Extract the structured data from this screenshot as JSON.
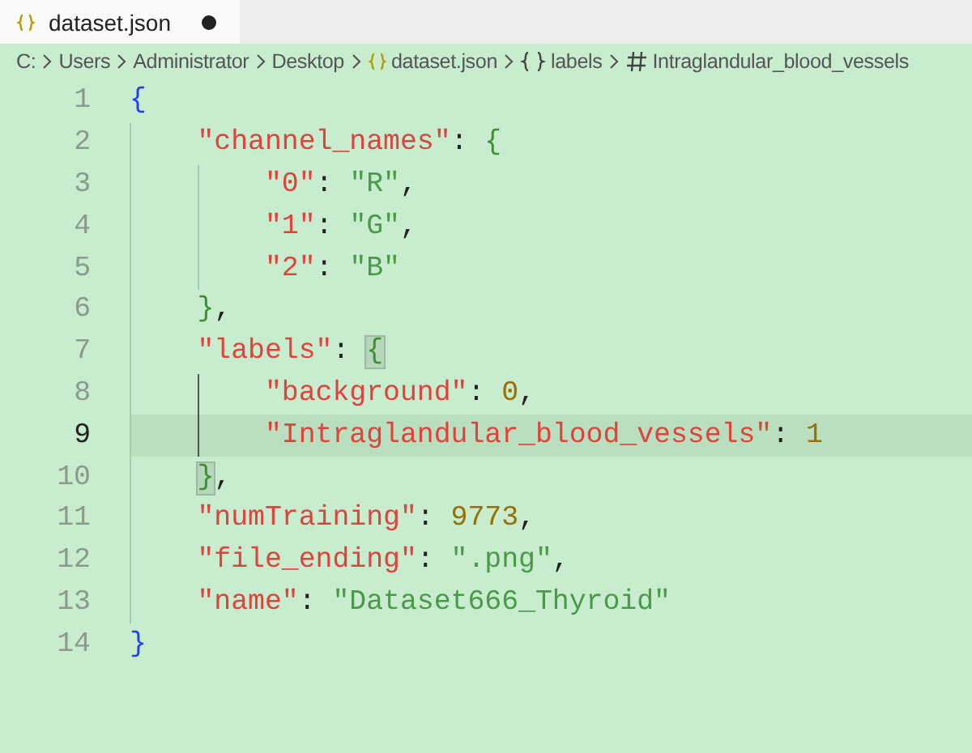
{
  "tab": {
    "title": "dataset.json",
    "modified": true,
    "selected": true
  },
  "breadcrumb": [
    {
      "label": "C:",
      "kind": "folder"
    },
    {
      "label": "Users",
      "kind": "folder"
    },
    {
      "label": "Administrator",
      "kind": "folder"
    },
    {
      "label": "Desktop",
      "kind": "folder"
    },
    {
      "label": "dataset.json",
      "kind": "file"
    },
    {
      "label": "labels",
      "kind": "object"
    },
    {
      "label": "Intraglandular_blood_vessels",
      "kind": "property"
    }
  ],
  "lines": [
    {
      "number": "1",
      "current": false,
      "tokens": [
        {
          "text": "{",
          "kind": "brace1"
        }
      ]
    },
    {
      "number": "2",
      "current": false,
      "tokens": [
        {
          "text": "    \"channel_names\"",
          "kind": "key"
        },
        {
          "text": ": ",
          "kind": "punct"
        },
        {
          "text": "{",
          "kind": "brace2"
        }
      ]
    },
    {
      "number": "3",
      "current": false,
      "tokens": [
        {
          "text": "        \"0\"",
          "kind": "key"
        },
        {
          "text": ": ",
          "kind": "punct"
        },
        {
          "text": "\"R\"",
          "kind": "string"
        },
        {
          "text": ",",
          "kind": "punct"
        }
      ]
    },
    {
      "number": "4",
      "current": false,
      "tokens": [
        {
          "text": "        \"1\"",
          "kind": "key"
        },
        {
          "text": ": ",
          "kind": "punct"
        },
        {
          "text": "\"G\"",
          "kind": "string"
        },
        {
          "text": ",",
          "kind": "punct"
        }
      ]
    },
    {
      "number": "5",
      "current": false,
      "tokens": [
        {
          "text": "        \"2\"",
          "kind": "key"
        },
        {
          "text": ": ",
          "kind": "punct"
        },
        {
          "text": "\"B\"",
          "kind": "string"
        }
      ]
    },
    {
      "number": "6",
      "current": false,
      "tokens": [
        {
          "text": "    }",
          "kind": "brace2"
        },
        {
          "text": ",",
          "kind": "punct"
        }
      ]
    },
    {
      "number": "7",
      "current": false,
      "tokens": [
        {
          "text": "    \"labels\"",
          "kind": "key"
        },
        {
          "text": ": ",
          "kind": "punct"
        },
        {
          "text": "{",
          "kind": "brace2",
          "matched": true
        }
      ]
    },
    {
      "number": "8",
      "current": false,
      "active_guide": true,
      "tokens": [
        {
          "text": "        \"background\"",
          "kind": "key"
        },
        {
          "text": ": ",
          "kind": "punct"
        },
        {
          "text": "0",
          "kind": "number"
        },
        {
          "text": ",",
          "kind": "punct"
        }
      ]
    },
    {
      "number": "9",
      "current": true,
      "active_guide": true,
      "tokens": [
        {
          "text": "        \"Intraglandular_blood_vessels\"",
          "kind": "key"
        },
        {
          "text": ": ",
          "kind": "punct"
        },
        {
          "text": "1",
          "kind": "number"
        }
      ]
    },
    {
      "number": "10",
      "current": false,
      "tokens": [
        {
          "text": "    }",
          "kind": "brace2",
          "matched": true
        },
        {
          "text": ",",
          "kind": "punct"
        }
      ]
    },
    {
      "number": "11",
      "current": false,
      "tokens": [
        {
          "text": "    \"numTraining\"",
          "kind": "key"
        },
        {
          "text": ": ",
          "kind": "punct"
        },
        {
          "text": "9773",
          "kind": "number"
        },
        {
          "text": ",",
          "kind": "punct"
        }
      ]
    },
    {
      "number": "12",
      "current": false,
      "tokens": [
        {
          "text": "    \"file_ending\"",
          "kind": "key"
        },
        {
          "text": ": ",
          "kind": "punct"
        },
        {
          "text": "\".png\"",
          "kind": "string"
        },
        {
          "text": ",",
          "kind": "punct"
        }
      ]
    },
    {
      "number": "13",
      "current": false,
      "tokens": [
        {
          "text": "    \"name\"",
          "kind": "key"
        },
        {
          "text": ": ",
          "kind": "punct"
        },
        {
          "text": "\"Dataset666_Thyroid\"",
          "kind": "string"
        }
      ]
    },
    {
      "number": "14",
      "current": false,
      "tokens": [
        {
          "text": "}",
          "kind": "brace1"
        }
      ]
    }
  ]
}
